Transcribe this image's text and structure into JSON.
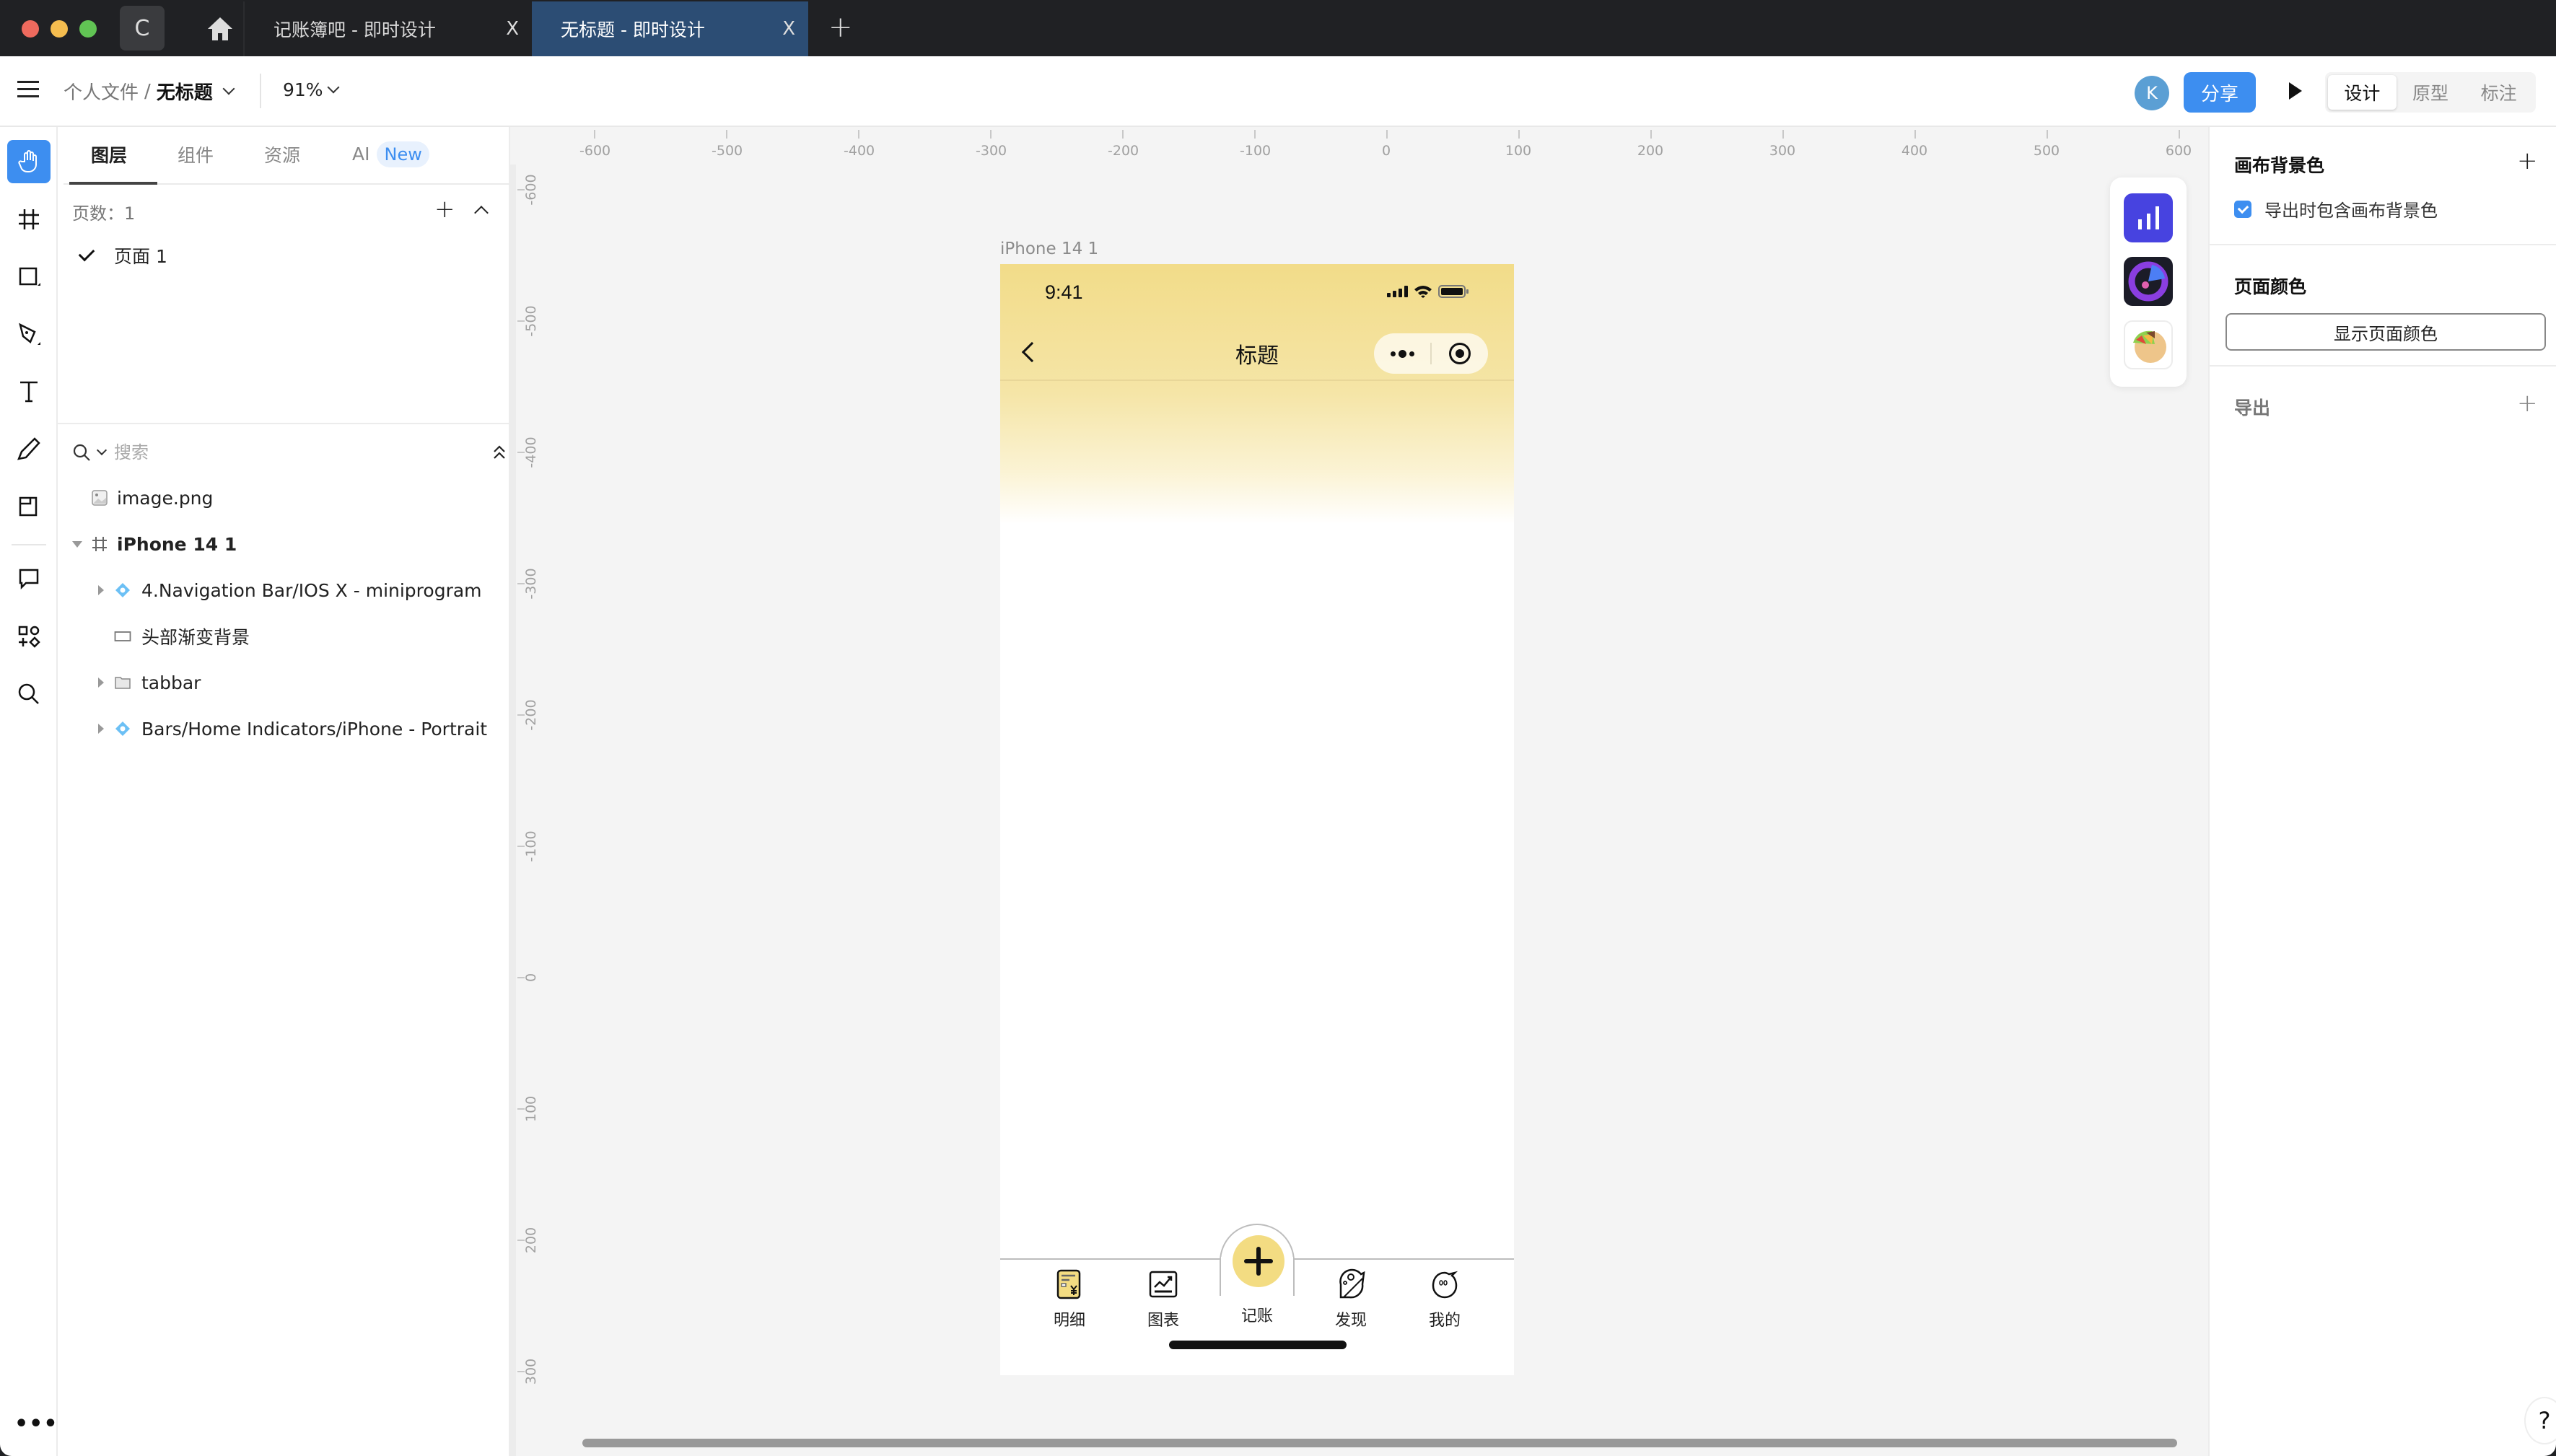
{
  "browser": {
    "tabs": [
      {
        "label": "记账簿吧 - 即时设计",
        "active": false
      },
      {
        "label": "无标题 - 即时设计",
        "active": true
      }
    ],
    "close_glyph": "X",
    "new_tab_glyph": "+",
    "reload_glyph": "C"
  },
  "toolbar": {
    "breadcrumb_parent": "个人文件",
    "breadcrumb_sep": "/",
    "file_name": "无标题",
    "zoom": "91%",
    "avatar_initial": "K",
    "share_label": "分享",
    "modes": [
      "设计",
      "原型",
      "标注"
    ],
    "active_mode": "设计"
  },
  "layers_panel": {
    "tabs": [
      "图层",
      "组件",
      "资源",
      "AI"
    ],
    "ai_badge": "New",
    "active_tab": "图层",
    "pages_count_label": "页数：1",
    "pages": [
      {
        "label": "页面 1",
        "selected": true
      }
    ],
    "search_placeholder": "搜索",
    "layers": [
      {
        "name": "image.png",
        "type": "image",
        "depth": 0,
        "expandable": false
      },
      {
        "name": "iPhone 14 1",
        "type": "frame",
        "depth": 0,
        "expandable": true,
        "expanded": true
      },
      {
        "name": "4.Navigation Bar/IOS X - miniprogram",
        "type": "component",
        "depth": 1,
        "expandable": true
      },
      {
        "name": "头部渐变背景",
        "type": "rectangle",
        "depth": 1,
        "expandable": false
      },
      {
        "name": "tabbar",
        "type": "group",
        "depth": 1,
        "expandable": true
      },
      {
        "name": "Bars/Home Indicators/iPhone - Portrait",
        "type": "component",
        "depth": 1,
        "expandable": true
      }
    ]
  },
  "canvas": {
    "hruler_ticks": [
      "-600",
      "-500",
      "-400",
      "-300",
      "-200",
      "-100",
      "0",
      "100",
      "200",
      "300",
      "400",
      "500",
      "600"
    ],
    "vruler_ticks": [
      "-600",
      "-500",
      "-400",
      "-300",
      "-200",
      "-100",
      "0",
      "100",
      "200",
      "300"
    ],
    "frame_label": "iPhone 14 1",
    "phone": {
      "status_time": "9:41",
      "nav_title": "标题",
      "tabbar": [
        {
          "label": "明细",
          "icon": "bill-detail-icon"
        },
        {
          "label": "图表",
          "icon": "chart-trend-icon"
        },
        {
          "label": "记账",
          "icon": "plus-icon"
        },
        {
          "label": "发现",
          "icon": "planet-icon"
        },
        {
          "label": "我的",
          "icon": "profile-face-icon"
        }
      ],
      "accent_color": "#f3dc82"
    },
    "plugins": [
      "bar-chart-plugin-icon",
      "radar-plugin-icon",
      "taco-plugin-icon"
    ]
  },
  "right_panel": {
    "canvas_bg_title": "画布背景色",
    "include_bg_label": "导出时包含画布背景色",
    "include_bg_checked": true,
    "page_color_title": "页面颜色",
    "show_page_color_label": "显示页面颜色",
    "export_title": "导出",
    "help_glyph": "?"
  },
  "colors": {
    "brand_blue": "#3d8ef0",
    "active_tab_bg": "#2c4d74",
    "titlebar_bg": "#202124",
    "canvas_bg": "#f4f4f4"
  }
}
